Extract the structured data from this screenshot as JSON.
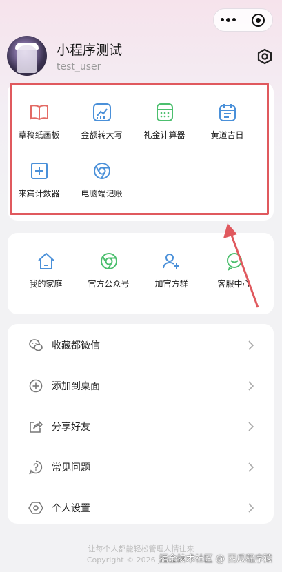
{
  "capsule": {
    "more_icon": "more-dots-icon",
    "close_icon": "target-close-icon"
  },
  "profile": {
    "name": "小程序测试",
    "id": "test_user",
    "settings_icon": "hexagon-settings-icon"
  },
  "tools": [
    {
      "label": "草稿纸画板",
      "icon": "book-icon",
      "color": "#e36a64"
    },
    {
      "label": "金额转大写",
      "icon": "chart-up-icon",
      "color": "#4a90d9"
    },
    {
      "label": "礼金计算器",
      "icon": "calculator-icon",
      "color": "#4cbf6e"
    },
    {
      "label": "黄道吉日",
      "icon": "calendar-icon",
      "color": "#4a90d9"
    },
    {
      "label": "来宾计数器",
      "icon": "plus-square-icon",
      "color": "#4a90d9"
    },
    {
      "label": "电脑端记账",
      "icon": "chrome-icon",
      "color": "#4a90d9"
    }
  ],
  "social": [
    {
      "label": "我的家庭",
      "icon": "home-icon"
    },
    {
      "label": "官方公众号",
      "icon": "chrome-green-icon"
    },
    {
      "label": "加官方群",
      "icon": "add-user-icon"
    },
    {
      "label": "客服中心",
      "icon": "wechat-icon"
    }
  ],
  "menu": [
    {
      "label": "收藏都微信",
      "icon": "wechat-outline-icon"
    },
    {
      "label": "添加到桌面",
      "icon": "plus-circle-icon"
    },
    {
      "label": "分享好友",
      "icon": "share-icon"
    },
    {
      "label": "常见问题",
      "icon": "question-icon"
    },
    {
      "label": "个人设置",
      "icon": "hexagon-icon"
    }
  ],
  "footer": {
    "slogan": "让每个人都能轻松管理人情往来",
    "copyright": "Copyright © 2026 jlm.kimi..."
  },
  "watermark": "掘金技术社区 @ 西瓜程序猿",
  "colors": {
    "highlight": "#e0595e",
    "green": "#4cbf6e",
    "blue": "#4a90d9",
    "red": "#e36a64"
  }
}
